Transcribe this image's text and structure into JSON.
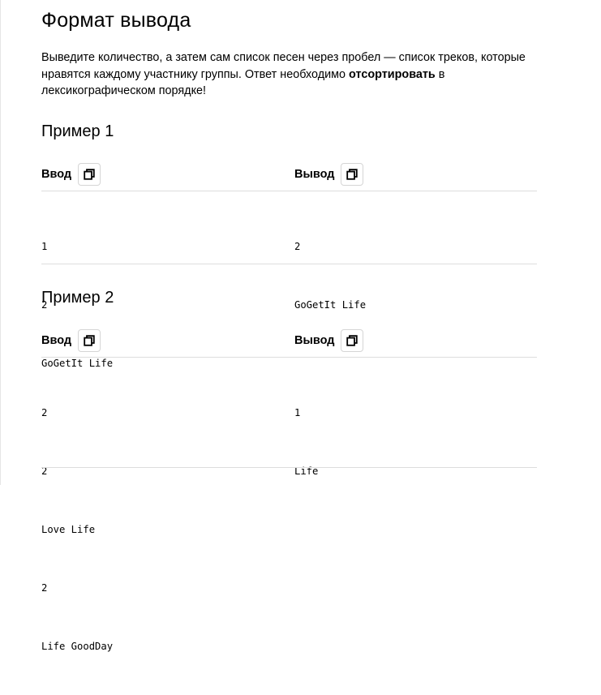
{
  "section": {
    "title": "Формат вывода",
    "text_before": "Выведите количество, а затем сам список песен через пробел — список треков, которые нравятся каждому участнику группы. Ответ необходимо ",
    "text_bold": "отсортировать",
    "text_after": " в лексикографическом порядке!"
  },
  "examples": [
    {
      "title": "Пример 1",
      "input_label": "Ввод",
      "output_label": "Вывод",
      "input_lines": [
        "1",
        "2",
        "GoGetIt Life"
      ],
      "output_lines": [
        "2",
        "GoGetIt Life"
      ]
    },
    {
      "title": "Пример 2",
      "input_label": "Ввод",
      "output_label": "Вывод",
      "input_lines": [
        "2",
        "2",
        "Love Life",
        "2",
        "Life GoodDay"
      ],
      "output_lines": [
        "1",
        "Life"
      ]
    }
  ],
  "icons": {
    "copy": "copy-icon"
  }
}
